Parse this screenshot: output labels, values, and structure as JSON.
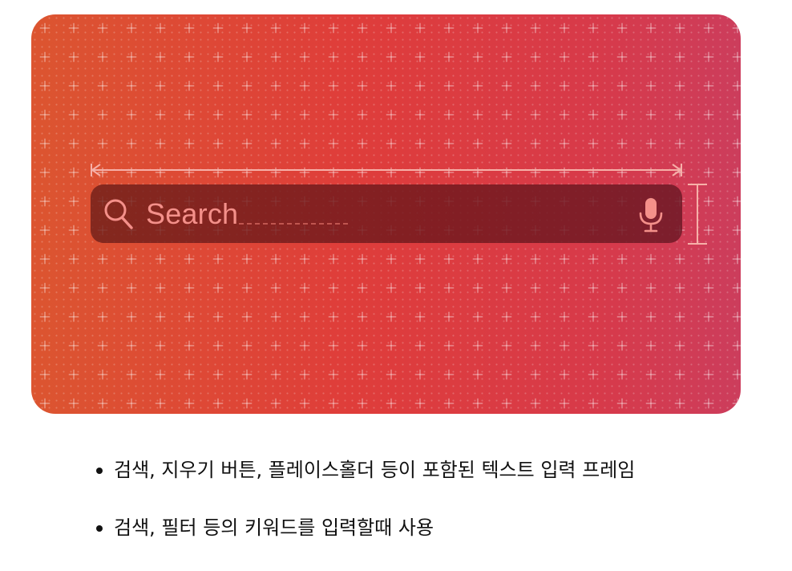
{
  "card": {
    "gradient_colors": [
      "#dc5530",
      "#df3d3a",
      "#d73a4a",
      "#cc3d5c"
    ]
  },
  "search_bar": {
    "placeholder": "Search",
    "left_icon": "magnifying-glass-icon",
    "right_icon": "microphone-icon",
    "accent_color": "#f4908a"
  },
  "annotations": {
    "width_guide": "double-arrow",
    "height_guide": "bracket"
  },
  "bullets": [
    "검색, 지우기 버튼, 플레이스홀더 등이 포함된 텍스트 입력 프레임",
    "검색, 필터 등의 키워드를 입력할때 사용"
  ]
}
